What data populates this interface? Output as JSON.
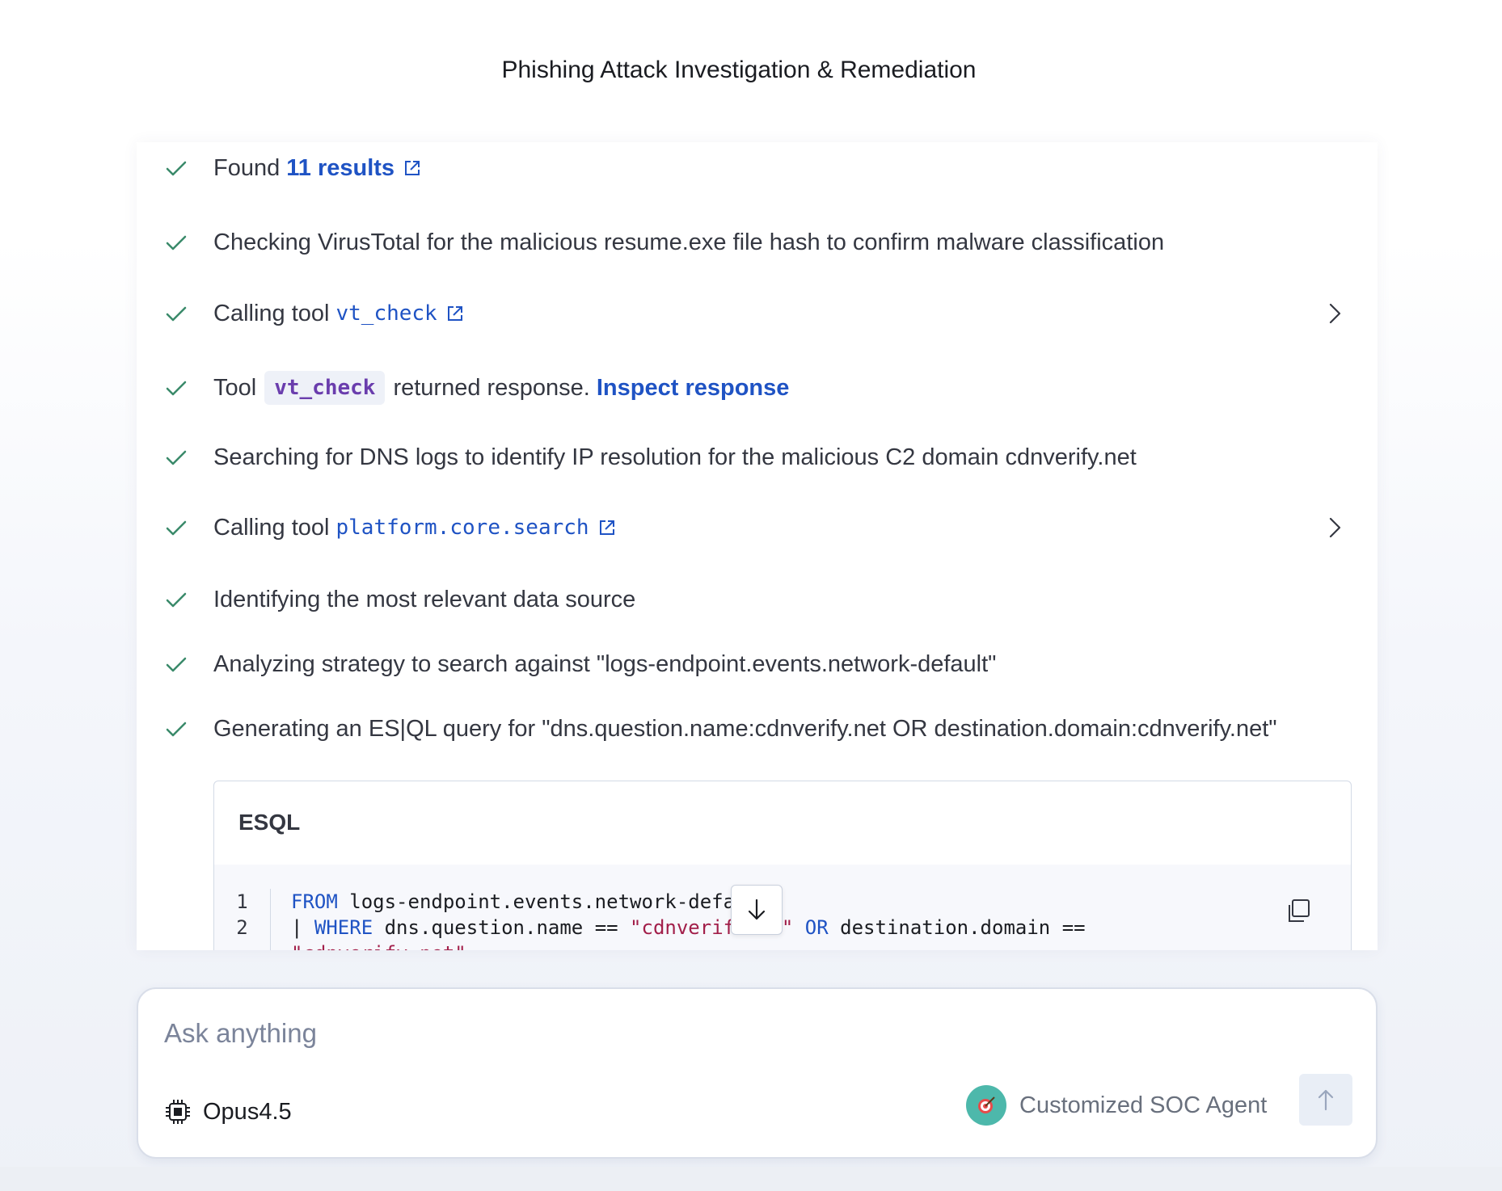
{
  "header": {
    "title": "Phishing Attack Investigation & Remediation"
  },
  "steps": [
    {
      "pre": "Found",
      "link": "11 results"
    },
    {
      "text": "Checking VirusTotal for the malicious resume.exe file hash to confirm malware classification"
    },
    {
      "pre": "Calling tool",
      "code": "vt_check"
    },
    {
      "pre": "Tool",
      "badge": "vt_check",
      "mid": "returned response.",
      "link": "Inspect response"
    },
    {
      "text": "Searching for DNS logs to identify IP resolution for the malicious C2 domain cdnverify.net"
    },
    {
      "pre": "Calling tool",
      "code": "platform.core.search"
    },
    {
      "text": "Identifying the most relevant data source"
    },
    {
      "text": "Analyzing strategy to search against \"logs-endpoint.events.network-default\""
    },
    {
      "text": "Generating an ES|QL query for \"dns.question.name:cdnverify.net OR destination.domain:cdnverify.net\""
    }
  ],
  "esql": {
    "title": "ESQL",
    "line_numbers": [
      "1",
      "2"
    ],
    "line1": {
      "kw": "FROM",
      "rest": " logs-endpoint.events.network-defa"
    },
    "line2": {
      "pipe": "| ",
      "kw": "WHERE",
      "mid": " dns.question.name == ",
      "str": "\"cdnverif   t\"",
      "kw2": " OR",
      "rest": " destination.domain =="
    },
    "line3": "\"cdnverify.net\""
  },
  "composer": {
    "placeholder": "Ask anything",
    "model": "Opus4.5",
    "agent": "Customized SOC Agent"
  },
  "icons": {
    "check": "check-icon",
    "external": "external-link-icon",
    "chevron": "chevron-right-icon",
    "copy": "copy-icon",
    "scroll": "arrow-down-icon",
    "chip": "cpu-chip-icon",
    "send": "arrow-up-icon"
  },
  "colors": {
    "link": "#1f53c4",
    "check": "#3a8a6a",
    "badge_text": "#6a3dad",
    "string": "#a21f4a",
    "agent_avatar": "#4db8ab"
  }
}
